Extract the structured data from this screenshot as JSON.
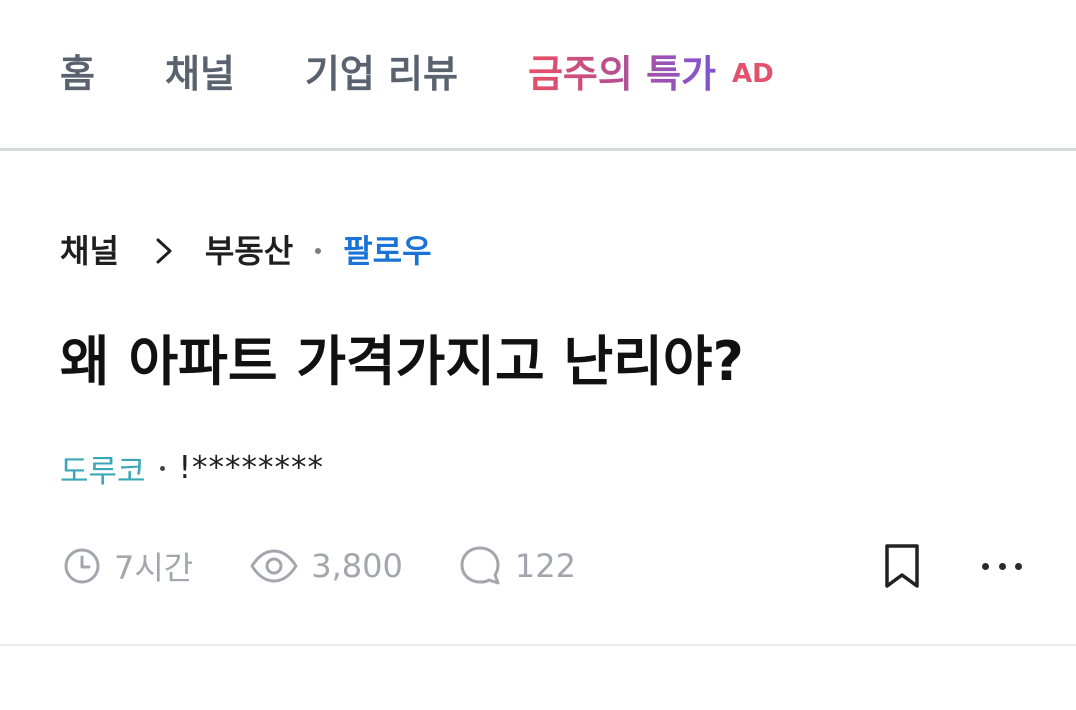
{
  "nav": {
    "items": [
      {
        "label": "홈"
      },
      {
        "label": "채널"
      },
      {
        "label": "기업 리뷰"
      }
    ],
    "promo": {
      "label": "금주의 특가",
      "badge": "AD"
    }
  },
  "breadcrumb": {
    "channel": "채널",
    "category": "부동산",
    "follow": "팔로우"
  },
  "post": {
    "title": "왜 아파트 가격가지고 난리야?",
    "author": "도루코",
    "company": "!********",
    "time": "7시간",
    "views": "3,800",
    "comments": "122"
  },
  "colors": {
    "nav_text": "#5a6270",
    "promo_gradient_start": "#ea4f62",
    "promo_gradient_end": "#7e55d6",
    "follow": "#1a73d6",
    "author": "#3aa7b8",
    "meta": "#a3a7ad"
  },
  "icons": {
    "breadcrumb_separator": "chevron-right-icon",
    "time": "clock-icon",
    "views": "eye-icon",
    "comments": "comment-icon",
    "bookmark": "bookmark-icon",
    "more": "more-icon"
  }
}
